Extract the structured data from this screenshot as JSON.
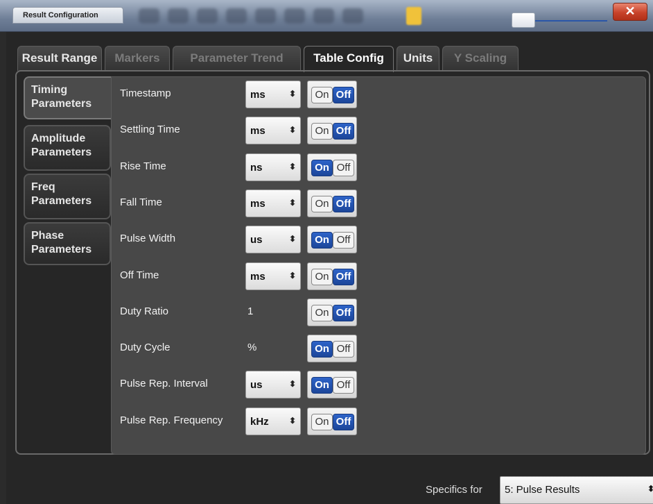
{
  "window": {
    "title": "Result Configuration",
    "close_glyph": "✕"
  },
  "tabs": [
    {
      "label": "Result Range",
      "state": "enabled"
    },
    {
      "label": "Markers",
      "state": "disabled"
    },
    {
      "label": "Parameter Trend",
      "state": "disabled"
    },
    {
      "label": "Table Config",
      "state": "active"
    },
    {
      "label": "Units",
      "state": "enabled"
    },
    {
      "label": "Y Scaling",
      "state": "disabled"
    }
  ],
  "subtabs": [
    {
      "label": "Timing Parameters",
      "active": true
    },
    {
      "label": "Amplitude Parameters",
      "active": false
    },
    {
      "label": "Freq Parameters",
      "active": false
    },
    {
      "label": "Phase Parameters",
      "active": false
    }
  ],
  "toggle_labels": {
    "on": "On",
    "off": "Off"
  },
  "dropdown_arrow": "⬍",
  "parameters": [
    {
      "label": "Timestamp",
      "unit": "ms",
      "unit_is_select": true,
      "state": "Off"
    },
    {
      "label": "Settling Time",
      "unit": "ms",
      "unit_is_select": true,
      "state": "Off"
    },
    {
      "label": "Rise Time",
      "unit": "ns",
      "unit_is_select": true,
      "state": "On"
    },
    {
      "label": "Fall Time",
      "unit": "ms",
      "unit_is_select": true,
      "state": "Off"
    },
    {
      "label": "Pulse Width",
      "unit": "us",
      "unit_is_select": true,
      "state": "On"
    },
    {
      "label": "Off Time",
      "unit": "ms",
      "unit_is_select": true,
      "state": "Off"
    },
    {
      "label": "Duty Ratio",
      "unit": "1",
      "unit_is_select": false,
      "state": "Off"
    },
    {
      "label": "Duty Cycle",
      "unit": "%",
      "unit_is_select": false,
      "state": "On"
    },
    {
      "label": "Pulse Rep. Interval",
      "unit": "us",
      "unit_is_select": true,
      "state": "On"
    },
    {
      "label": "Pulse Rep. Frequency",
      "unit": "kHz",
      "unit_is_select": true,
      "state": "Off"
    }
  ],
  "footer": {
    "label": "Specifics for",
    "selected": "5: Pulse Results"
  },
  "colors": {
    "toggle_selected": "#2d63c8",
    "close_button": "#c8432a",
    "background": "#262626"
  }
}
